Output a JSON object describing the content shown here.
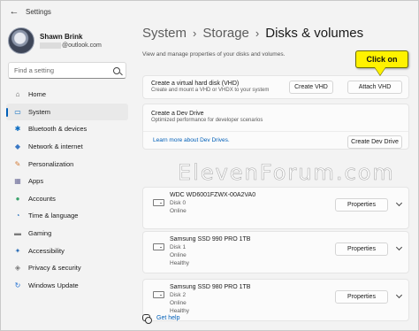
{
  "window": {
    "title": "Settings"
  },
  "profile": {
    "name": "Shawn Brink",
    "email": "@outlook.com"
  },
  "search": {
    "placeholder": "Find a setting"
  },
  "sidebar": {
    "items": [
      {
        "label": "Home",
        "icon": "home-icon",
        "color": "#5b5b5b",
        "active": false
      },
      {
        "label": "System",
        "icon": "system-icon",
        "color": "#0067c0",
        "active": true
      },
      {
        "label": "Bluetooth & devices",
        "icon": "bluetooth-icon",
        "color": "#0067c0",
        "active": false
      },
      {
        "label": "Network & internet",
        "icon": "wifi-icon",
        "color": "#3a78c4",
        "active": false
      },
      {
        "label": "Personalization",
        "icon": "brush-icon",
        "color": "#d27a34",
        "active": false
      },
      {
        "label": "Apps",
        "icon": "apps-icon",
        "color": "#6f6f9a",
        "active": false
      },
      {
        "label": "Accounts",
        "icon": "person-icon",
        "color": "#3aa26b",
        "active": false
      },
      {
        "label": "Time & language",
        "icon": "globe-clock-icon",
        "color": "#2f77c0",
        "active": false
      },
      {
        "label": "Gaming",
        "icon": "controller-icon",
        "color": "#7a7a7a",
        "active": false
      },
      {
        "label": "Accessibility",
        "icon": "accessibility-icon",
        "color": "#2f6fb7",
        "active": false
      },
      {
        "label": "Privacy & security",
        "icon": "shield-icon",
        "color": "#7a7a7a",
        "active": false
      },
      {
        "label": "Windows Update",
        "icon": "update-icon",
        "color": "#1f6fd1",
        "active": false
      }
    ]
  },
  "breadcrumb": {
    "items": [
      "System",
      "Storage",
      "Disks & volumes"
    ]
  },
  "main": {
    "description": "View and manage properties of your disks and volumes.",
    "vhd": {
      "title": "Create a virtual hard disk (VHD)",
      "subtitle": "Create and mount a VHD or VHDX to your system",
      "create_label": "Create VHD",
      "attach_label": "Attach VHD"
    },
    "dev_drive": {
      "title": "Create a Dev Drive",
      "subtitle": "Optimized performance for developer scenarios",
      "link": "Learn more about Dev Drives.",
      "button_label": "Create Dev Drive"
    },
    "disks": [
      {
        "name": "WDC WD6001FZWX-00A2VA0",
        "disk": "Disk 0",
        "status": "Online",
        "health": "",
        "button_label": "Properties"
      },
      {
        "name": "Samsung SSD 990 PRO 1TB",
        "disk": "Disk 1",
        "status": "Online",
        "health": "Healthy",
        "button_label": "Properties"
      },
      {
        "name": "Samsung SSD 980 PRO 1TB",
        "disk": "Disk 2",
        "status": "Online",
        "health": "Healthy",
        "button_label": "Properties"
      }
    ],
    "help": {
      "label": "Get help"
    }
  },
  "callout": {
    "text": "Click on",
    "color": "#fff200"
  },
  "watermark": {
    "text": "ElevenForum.com"
  },
  "colors": {
    "accent": "#005fb8",
    "background": "#f3f3f3",
    "card": "#fbfbfb"
  }
}
